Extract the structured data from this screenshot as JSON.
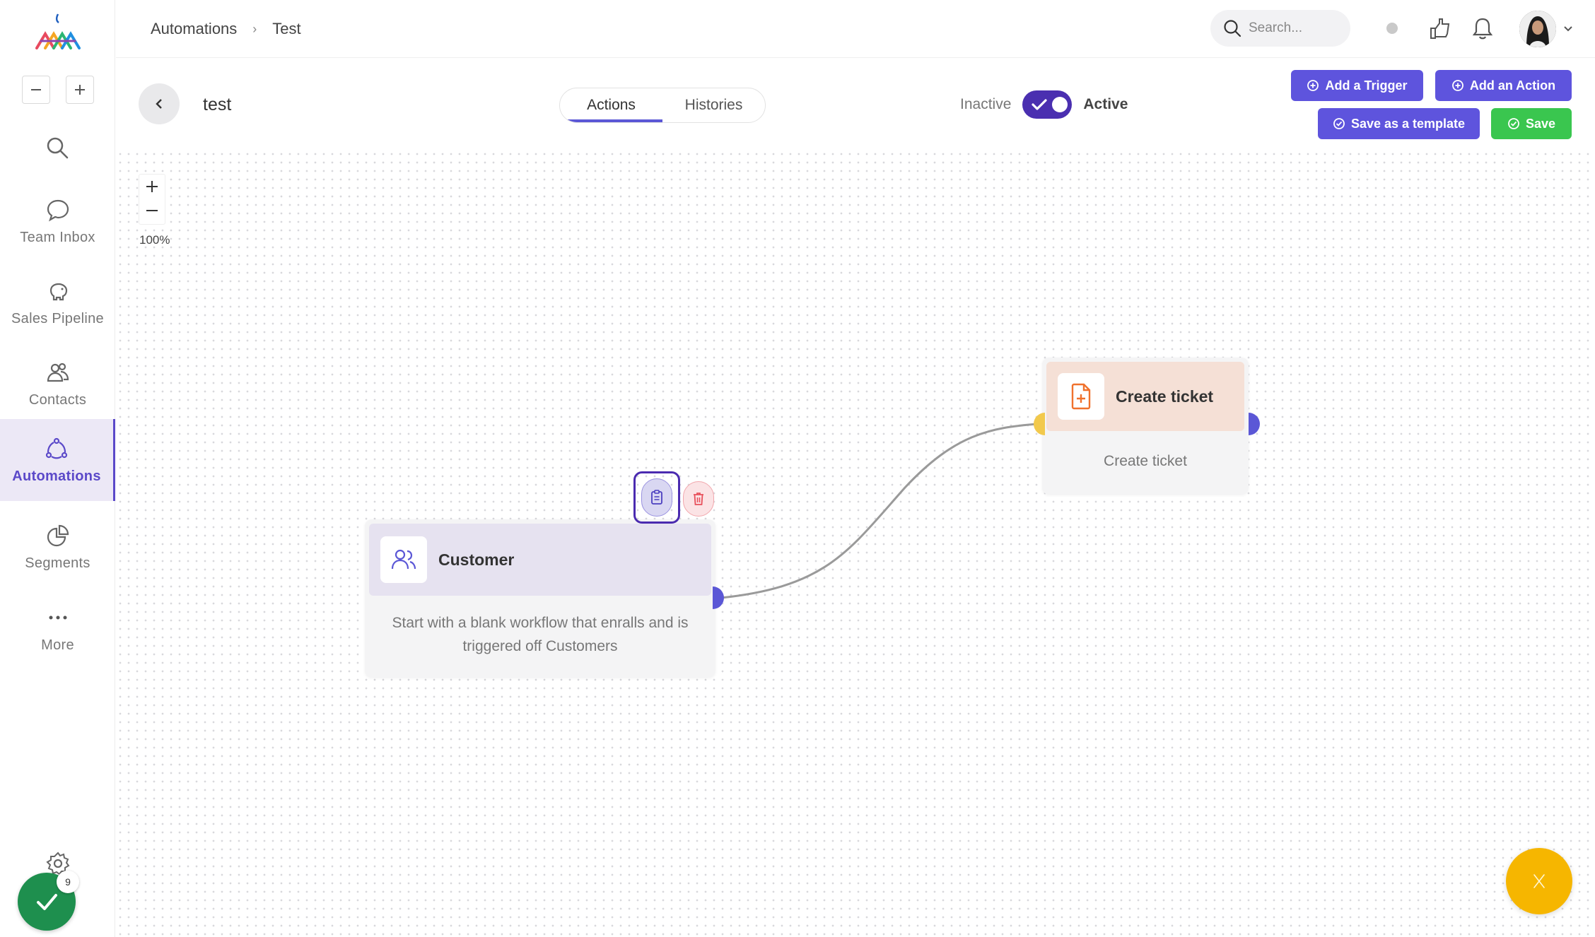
{
  "sidebar": {
    "items": [
      {
        "label": "Team Inbox",
        "icon": "chat-bubble-icon"
      },
      {
        "label": "Sales Pipeline",
        "icon": "piggy-bank-icon"
      },
      {
        "label": "Contacts",
        "icon": "contacts-icon"
      },
      {
        "label": "Automations",
        "icon": "automation-cycle-icon",
        "active": true
      },
      {
        "label": "Segments",
        "icon": "pie-chart-icon"
      },
      {
        "label": "More",
        "icon": "more-dots-icon"
      }
    ],
    "notification_count": "9"
  },
  "header": {
    "breadcrumb": [
      "Automations",
      "Test"
    ],
    "search_placeholder": "Search..."
  },
  "workflow": {
    "name": "test",
    "tabs": [
      {
        "label": "Actions",
        "active": true
      },
      {
        "label": "Histories",
        "active": false
      }
    ],
    "toggle": {
      "off_label": "Inactive",
      "on_label": "Active",
      "state": "active"
    }
  },
  "actions": {
    "add_trigger": "Add a Trigger",
    "add_action": "Add an Action",
    "save_template": "Save as a template",
    "save": "Save"
  },
  "canvas": {
    "zoom_in": "+",
    "zoom_out": "−",
    "zoom_level": "100%",
    "trigger_node": {
      "title": "Customer",
      "description": "Start with a blank workflow that enralls and is triggered off Customers",
      "icon": "users-icon"
    },
    "action_node": {
      "title": "Create ticket",
      "description": "Create ticket",
      "icon": "file-plus-icon"
    }
  },
  "colors": {
    "brand_purple": "#5e54dd",
    "toggle_purple": "#4a2fb0",
    "save_green": "#3ac64f",
    "trigger_header": "#e6e2f0",
    "action_header": "#f5e0d6",
    "port_blue": "#5b57d6",
    "port_yellow": "#f2c94c",
    "chat_fab": "#f6b600",
    "check_fab": "#1e8f4e"
  }
}
